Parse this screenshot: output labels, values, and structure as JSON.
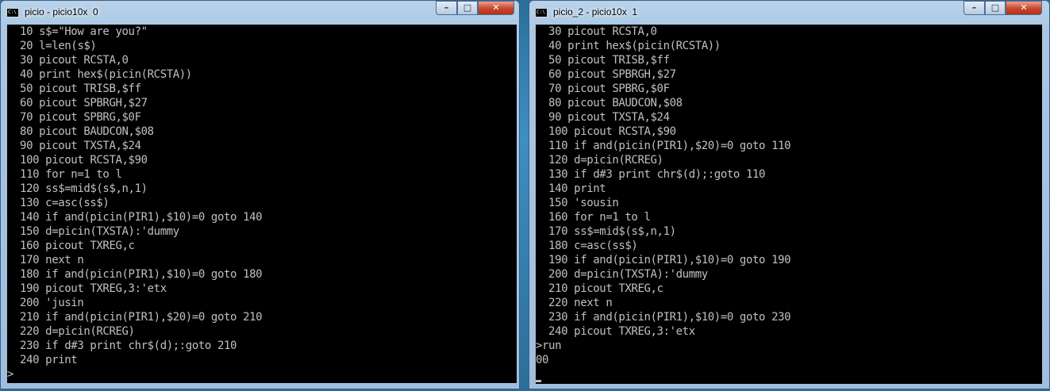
{
  "windows": [
    {
      "title": "picio - picio10x  0",
      "icon": "command-prompt-icon",
      "lines": [
        "  10 s$=\"How are you?\"",
        "  20 l=len(s$)",
        "  30 picout RCSTA,0",
        "  40 print hex$(picin(RCSTA))",
        "  50 picout TRISB,$ff",
        "  60 picout SPBRGH,$27",
        "  70 picout SPBRG,$0F",
        "  80 picout BAUDCON,$08",
        "  90 picout TXSTA,$24",
        "  100 picout RCSTA,$90",
        "  110 for n=1 to l",
        "  120 ss$=mid$(s$,n,1)",
        "  130 c=asc(ss$)",
        "  140 if and(picin(PIR1),$10)=0 goto 140",
        "  150 d=picin(TXSTA):'dummy",
        "  160 picout TXREG,c",
        "  170 next n",
        "  180 if and(picin(PIR1),$10)=0 goto 180",
        "  190 picout TXREG,3:'etx",
        "  200 'jusin",
        "  210 if and(picin(PIR1),$20)=0 goto 210",
        "  220 d=picin(RCREG)",
        "  230 if d#3 print chr$(d);:goto 210",
        "  240 print",
        ">"
      ]
    },
    {
      "title": "picio_2 - picio10x  1",
      "icon": "command-prompt-icon",
      "lines": [
        "  30 picout RCSTA,0",
        "  40 print hex$(picin(RCSTA))",
        "  50 picout TRISB,$ff",
        "  60 picout SPBRGH,$27",
        "  70 picout SPBRG,$0F",
        "  80 picout BAUDCON,$08",
        "  90 picout TXSTA,$24",
        "  100 picout RCSTA,$90",
        "  110 if and(picin(PIR1),$20)=0 goto 110",
        "  120 d=picin(RCREG)",
        "  130 if d#3 print chr$(d);:goto 110",
        "  140 print",
        "  150 'sousin",
        "  160 for n=1 to l",
        "  170 ss$=mid$(s$,n,1)",
        "  180 c=asc(ss$)",
        "  190 if and(picin(PIR1),$10)=0 goto 190",
        "  200 d=picin(TXSTA):'dummy",
        "  210 picout TXREG,c",
        "  220 next n",
        "  230 if and(picin(PIR1),$10)=0 goto 230",
        "  240 picout TXREG,3:'etx",
        ">run",
        "00",
        ""
      ]
    }
  ],
  "controls": {
    "minimize_glyph": "–",
    "maximize_glyph": "□",
    "close_glyph": "✕",
    "icon_glyph": "C:\\"
  },
  "colors": {
    "console_bg": "#000000",
    "console_fg": "#c0c0c0",
    "close_red": "#c9452c"
  }
}
